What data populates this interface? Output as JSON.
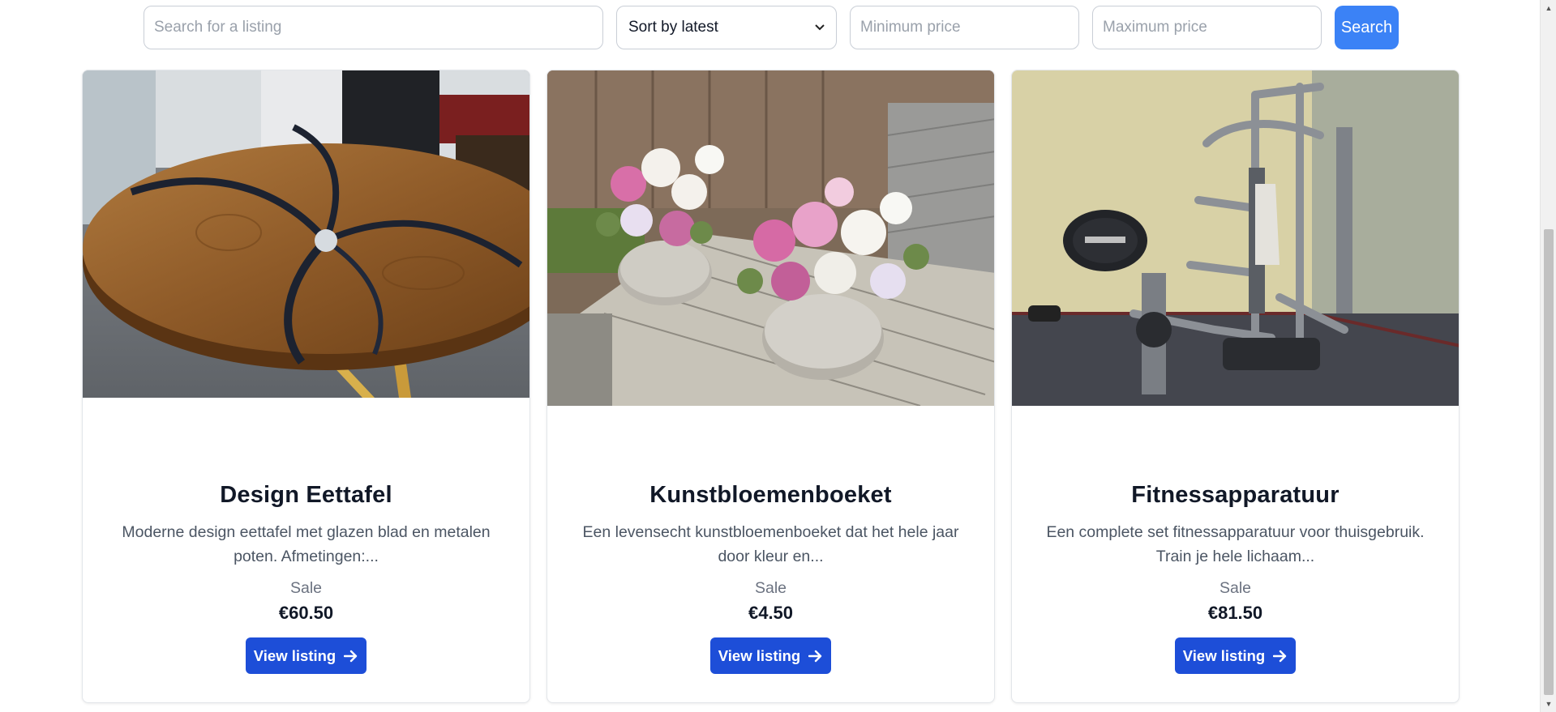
{
  "filters": {
    "search_placeholder": "Search for a listing",
    "sort_selected": "Sort by latest",
    "min_price_placeholder": "Minimum price",
    "max_price_placeholder": "Maximum price",
    "search_button": "Search"
  },
  "listings": [
    {
      "title": "Design Eettafel",
      "description": "Moderne design eettafel met glazen blad en metalen poten. Afmetingen:...",
      "type": "Sale",
      "price": "€60.50",
      "button": "View listing"
    },
    {
      "title": "Kunstbloemenboeket",
      "description": "Een levensecht kunstbloemenboeket dat het hele jaar door kleur en...",
      "type": "Sale",
      "price": "€4.50",
      "button": "View listing"
    },
    {
      "title": "Fitnessapparatuur",
      "description": "Een complete set fitnessapparatuur voor thuisgebruik. Train je hele lichaam...",
      "type": "Sale",
      "price": "€81.50",
      "button": "View listing"
    }
  ],
  "colors": {
    "primary_button": "#1d4ed8",
    "search_button": "#3b82f6"
  }
}
